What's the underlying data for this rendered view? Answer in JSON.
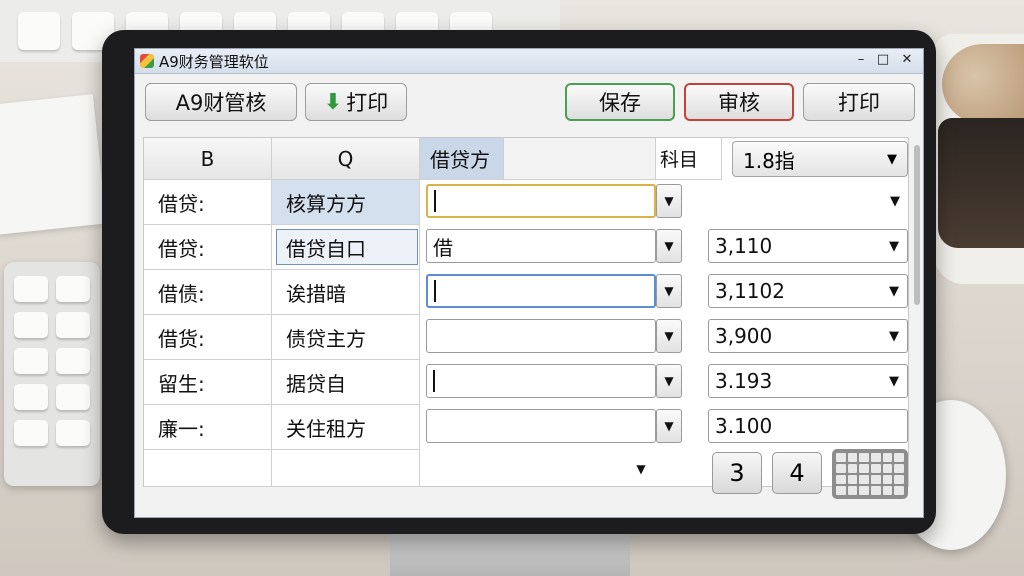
{
  "window": {
    "title": "A9财务管理软位"
  },
  "toolbar": {
    "btn1_label": "A9财管核",
    "btn2_label": "打印",
    "save_label": "保存",
    "review_label": "审核",
    "print_label": "打印"
  },
  "grid": {
    "headers": [
      "B",
      "Q",
      "借贷方",
      "科目",
      "1.8指"
    ],
    "rows": [
      {
        "label": "借贷:",
        "name": "核算方方",
        "value": ""
      },
      {
        "label": "借贷:",
        "name": "借贷自口",
        "value": "3,110",
        "input": "借"
      },
      {
        "label": "借债:",
        "name": "诶措暗",
        "value": "3,1102"
      },
      {
        "label": "借货:",
        "name": "债贷主方",
        "value": "3,900"
      },
      {
        "label": "留生:",
        "name": "据贷自",
        "value": "3.193"
      },
      {
        "label": "廉一:",
        "name": "关住租方",
        "value": "3.100"
      }
    ]
  },
  "keypad": {
    "key_a": "3",
    "key_b": "4"
  },
  "icons": [
    "app-icon",
    "minimize-icon",
    "maximize-icon",
    "close-icon",
    "plus-icon",
    "chevron-down-icon",
    "calculator-icon"
  ]
}
